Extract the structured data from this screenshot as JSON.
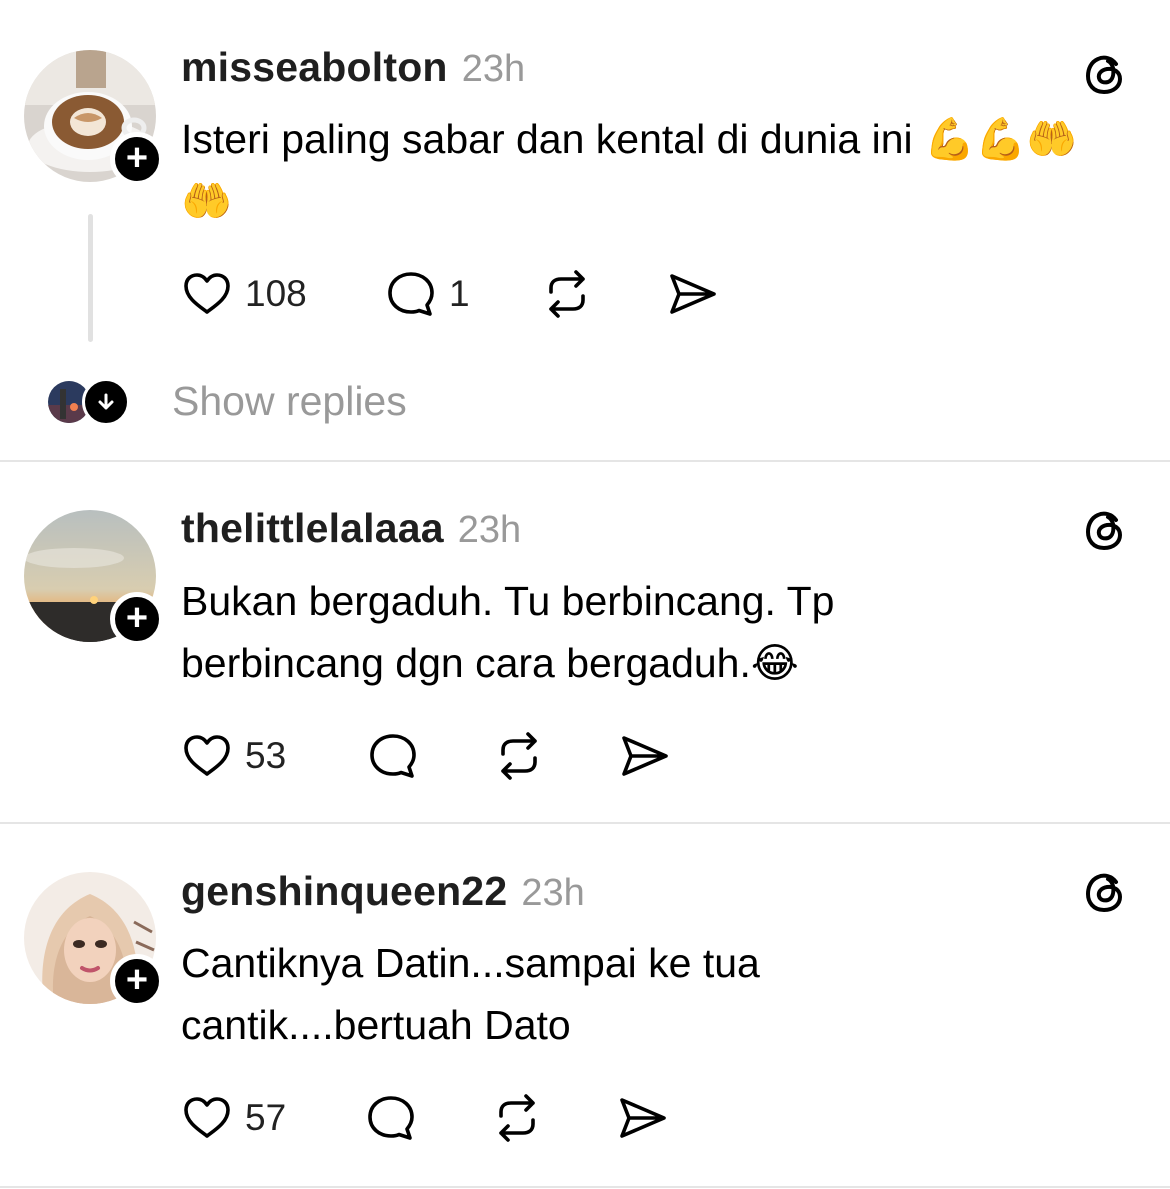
{
  "posts": [
    {
      "username": "misseabolton",
      "time": "23h",
      "text": "Isteri paling sabar dan kental di dunia ini 💪💪🤲🤲",
      "likes": "108",
      "replies_count": "1",
      "show_replies": "Show replies"
    },
    {
      "username": "thelittlelalaaa",
      "time": "23h",
      "text": "Bukan bergaduh. Tu berbincang. Tp berbincang dgn cara bergaduh.😂",
      "likes": "53"
    },
    {
      "username": "genshinqueen22",
      "time": "23h",
      "text": "Cantiknya Datin...sampai ke tua cantik....bertuah Dato",
      "likes": "57"
    }
  ],
  "icons": {
    "follow": "+",
    "threads": "threads-logo-icon",
    "like": "heart-icon",
    "reply": "comment-icon",
    "repost": "repost-icon",
    "share": "send-icon",
    "expand": "arrow-down-icon"
  }
}
